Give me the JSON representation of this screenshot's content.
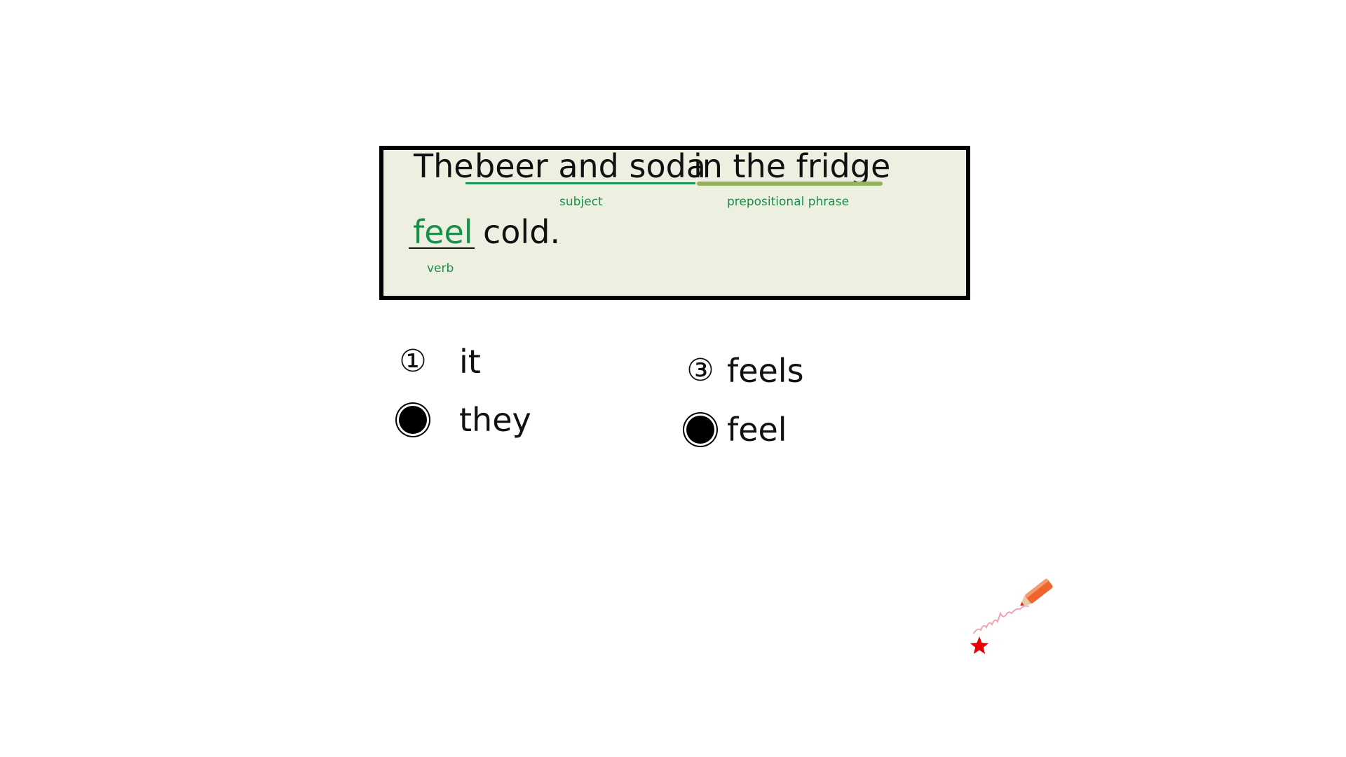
{
  "sentence": {
    "line1": {
      "word_the": "The",
      "subject_text": "beer and soda",
      "prep_text": "in the fridge"
    },
    "line2": {
      "verb_text": "feel",
      "rest_text": "cold."
    },
    "tags": {
      "subject": "subject",
      "prepositional_phrase": "prepositional phrase",
      "verb": "verb"
    }
  },
  "options": [
    {
      "marker": "①",
      "text": "it",
      "selected": false
    },
    {
      "marker": "",
      "text": "they",
      "selected": true
    },
    {
      "marker": "③",
      "text": "feels",
      "selected": false
    },
    {
      "marker": "",
      "text": "feel",
      "selected": true
    }
  ],
  "colors": {
    "box_background": "#edf0e0",
    "label_green": "#1a8f4a",
    "highlight_green": "#93b55a",
    "star_red": "#e60000",
    "pencil_orange": "#f0642e"
  },
  "icons": {
    "star": "red-star-icon",
    "pencil": "red-pencil-icon"
  }
}
